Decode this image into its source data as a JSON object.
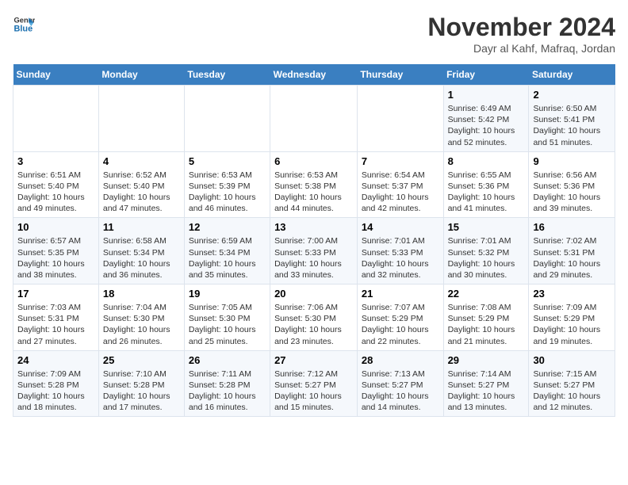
{
  "logo": {
    "line1": "General",
    "line2": "Blue"
  },
  "title": "November 2024",
  "location": "Dayr al Kahf, Mafraq, Jordan",
  "weekdays": [
    "Sunday",
    "Monday",
    "Tuesday",
    "Wednesday",
    "Thursday",
    "Friday",
    "Saturday"
  ],
  "weeks": [
    [
      {
        "day": "",
        "info": ""
      },
      {
        "day": "",
        "info": ""
      },
      {
        "day": "",
        "info": ""
      },
      {
        "day": "",
        "info": ""
      },
      {
        "day": "",
        "info": ""
      },
      {
        "day": "1",
        "info": "Sunrise: 6:49 AM\nSunset: 5:42 PM\nDaylight: 10 hours\nand 52 minutes."
      },
      {
        "day": "2",
        "info": "Sunrise: 6:50 AM\nSunset: 5:41 PM\nDaylight: 10 hours\nand 51 minutes."
      }
    ],
    [
      {
        "day": "3",
        "info": "Sunrise: 6:51 AM\nSunset: 5:40 PM\nDaylight: 10 hours\nand 49 minutes."
      },
      {
        "day": "4",
        "info": "Sunrise: 6:52 AM\nSunset: 5:40 PM\nDaylight: 10 hours\nand 47 minutes."
      },
      {
        "day": "5",
        "info": "Sunrise: 6:53 AM\nSunset: 5:39 PM\nDaylight: 10 hours\nand 46 minutes."
      },
      {
        "day": "6",
        "info": "Sunrise: 6:53 AM\nSunset: 5:38 PM\nDaylight: 10 hours\nand 44 minutes."
      },
      {
        "day": "7",
        "info": "Sunrise: 6:54 AM\nSunset: 5:37 PM\nDaylight: 10 hours\nand 42 minutes."
      },
      {
        "day": "8",
        "info": "Sunrise: 6:55 AM\nSunset: 5:36 PM\nDaylight: 10 hours\nand 41 minutes."
      },
      {
        "day": "9",
        "info": "Sunrise: 6:56 AM\nSunset: 5:36 PM\nDaylight: 10 hours\nand 39 minutes."
      }
    ],
    [
      {
        "day": "10",
        "info": "Sunrise: 6:57 AM\nSunset: 5:35 PM\nDaylight: 10 hours\nand 38 minutes."
      },
      {
        "day": "11",
        "info": "Sunrise: 6:58 AM\nSunset: 5:34 PM\nDaylight: 10 hours\nand 36 minutes."
      },
      {
        "day": "12",
        "info": "Sunrise: 6:59 AM\nSunset: 5:34 PM\nDaylight: 10 hours\nand 35 minutes."
      },
      {
        "day": "13",
        "info": "Sunrise: 7:00 AM\nSunset: 5:33 PM\nDaylight: 10 hours\nand 33 minutes."
      },
      {
        "day": "14",
        "info": "Sunrise: 7:01 AM\nSunset: 5:33 PM\nDaylight: 10 hours\nand 32 minutes."
      },
      {
        "day": "15",
        "info": "Sunrise: 7:01 AM\nSunset: 5:32 PM\nDaylight: 10 hours\nand 30 minutes."
      },
      {
        "day": "16",
        "info": "Sunrise: 7:02 AM\nSunset: 5:31 PM\nDaylight: 10 hours\nand 29 minutes."
      }
    ],
    [
      {
        "day": "17",
        "info": "Sunrise: 7:03 AM\nSunset: 5:31 PM\nDaylight: 10 hours\nand 27 minutes."
      },
      {
        "day": "18",
        "info": "Sunrise: 7:04 AM\nSunset: 5:30 PM\nDaylight: 10 hours\nand 26 minutes."
      },
      {
        "day": "19",
        "info": "Sunrise: 7:05 AM\nSunset: 5:30 PM\nDaylight: 10 hours\nand 25 minutes."
      },
      {
        "day": "20",
        "info": "Sunrise: 7:06 AM\nSunset: 5:30 PM\nDaylight: 10 hours\nand 23 minutes."
      },
      {
        "day": "21",
        "info": "Sunrise: 7:07 AM\nSunset: 5:29 PM\nDaylight: 10 hours\nand 22 minutes."
      },
      {
        "day": "22",
        "info": "Sunrise: 7:08 AM\nSunset: 5:29 PM\nDaylight: 10 hours\nand 21 minutes."
      },
      {
        "day": "23",
        "info": "Sunrise: 7:09 AM\nSunset: 5:29 PM\nDaylight: 10 hours\nand 19 minutes."
      }
    ],
    [
      {
        "day": "24",
        "info": "Sunrise: 7:09 AM\nSunset: 5:28 PM\nDaylight: 10 hours\nand 18 minutes."
      },
      {
        "day": "25",
        "info": "Sunrise: 7:10 AM\nSunset: 5:28 PM\nDaylight: 10 hours\nand 17 minutes."
      },
      {
        "day": "26",
        "info": "Sunrise: 7:11 AM\nSunset: 5:28 PM\nDaylight: 10 hours\nand 16 minutes."
      },
      {
        "day": "27",
        "info": "Sunrise: 7:12 AM\nSunset: 5:27 PM\nDaylight: 10 hours\nand 15 minutes."
      },
      {
        "day": "28",
        "info": "Sunrise: 7:13 AM\nSunset: 5:27 PM\nDaylight: 10 hours\nand 14 minutes."
      },
      {
        "day": "29",
        "info": "Sunrise: 7:14 AM\nSunset: 5:27 PM\nDaylight: 10 hours\nand 13 minutes."
      },
      {
        "day": "30",
        "info": "Sunrise: 7:15 AM\nSunset: 5:27 PM\nDaylight: 10 hours\nand 12 minutes."
      }
    ]
  ]
}
